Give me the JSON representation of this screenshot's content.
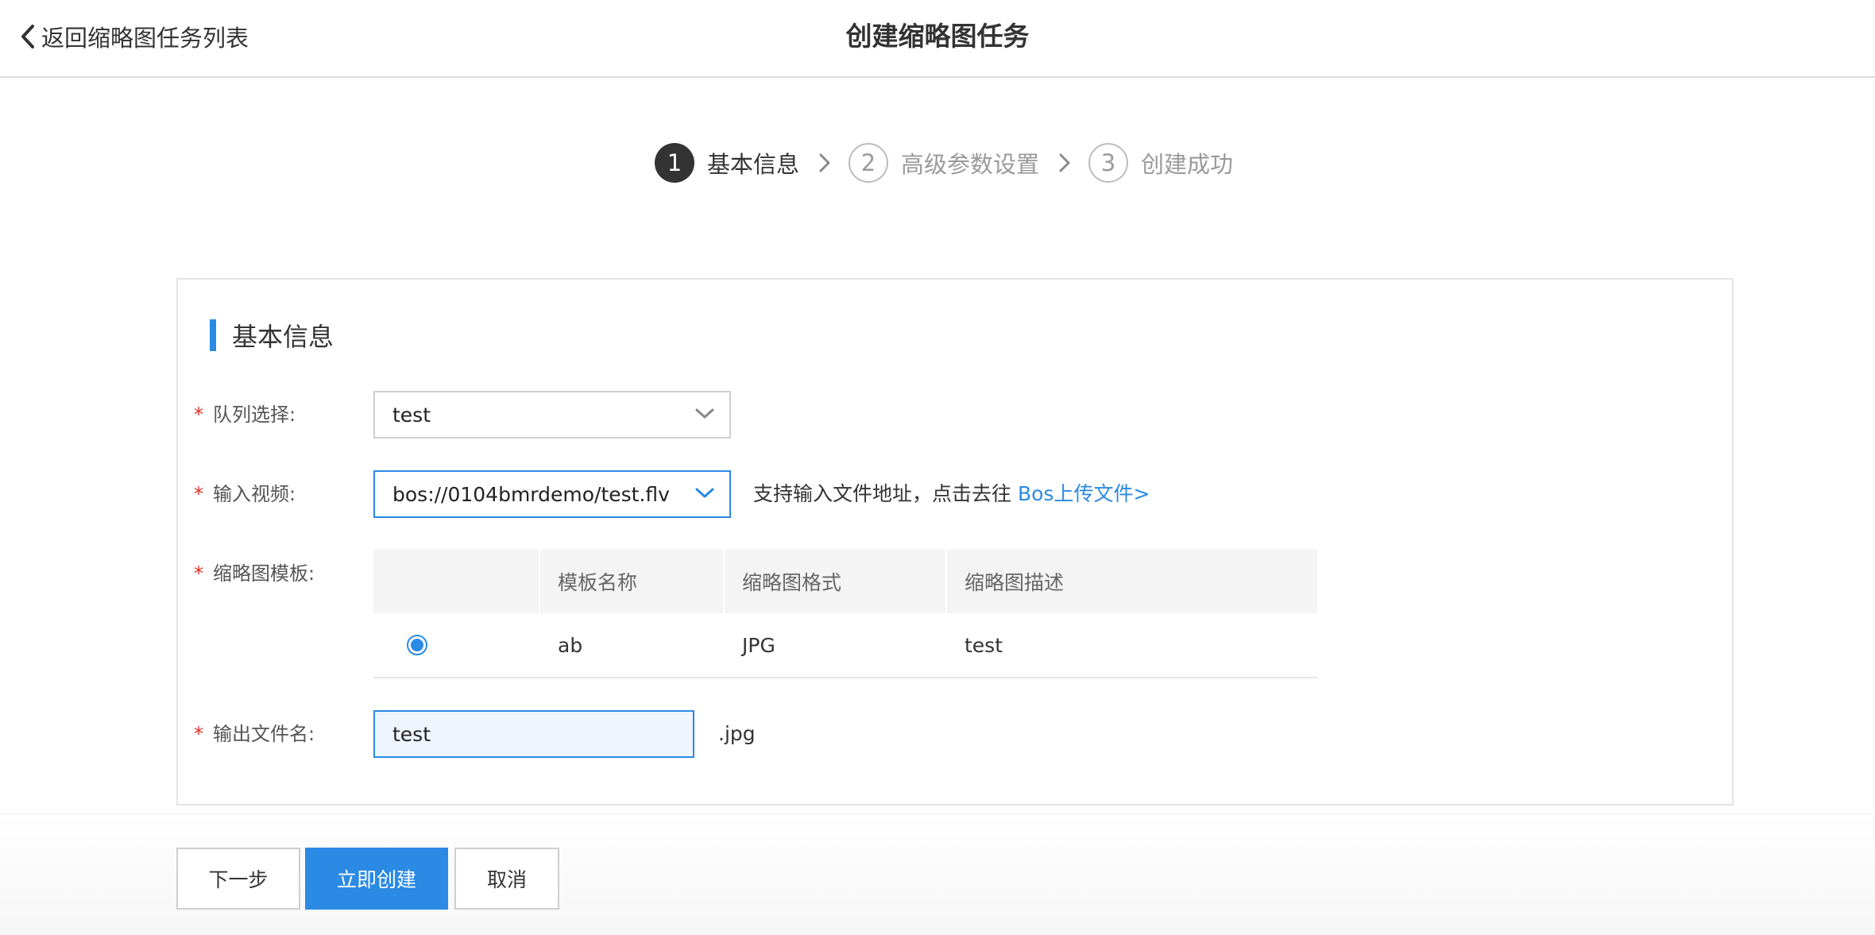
{
  "header": {
    "back_label": "返回缩略图任务列表",
    "title": "创建缩略图任务"
  },
  "steps": [
    {
      "number": "1",
      "label": "基本信息",
      "state": "active"
    },
    {
      "number": "2",
      "label": "高级参数设置",
      "state": "inactive"
    },
    {
      "number": "3",
      "label": "创建成功",
      "state": "inactive"
    }
  ],
  "form": {
    "section_title": "基本信息",
    "required_mark": "*",
    "queue": {
      "label": "队列选择:",
      "value": "test"
    },
    "input_video": {
      "label": "输入视频:",
      "value": "bos://0104bmrdemo/test.flv",
      "hint": "支持输入文件地址，点击去往",
      "hint_link": "Bos上传文件>"
    },
    "template": {
      "label": "缩略图模板:",
      "columns": [
        "",
        "模板名称",
        "缩略图格式",
        "缩略图描述"
      ],
      "rows": [
        {
          "selected": true,
          "name": "ab",
          "format": "JPG",
          "description": "test"
        }
      ]
    },
    "output": {
      "label": "输出文件名:",
      "value": "test",
      "suffix": ".jpg"
    }
  },
  "footer": {
    "next_label": "下一步",
    "create_label": "立即创建",
    "cancel_label": "取消"
  },
  "colors": {
    "accent": "#2a8ae4",
    "required": "#e02e24",
    "active_step": "#333333"
  }
}
